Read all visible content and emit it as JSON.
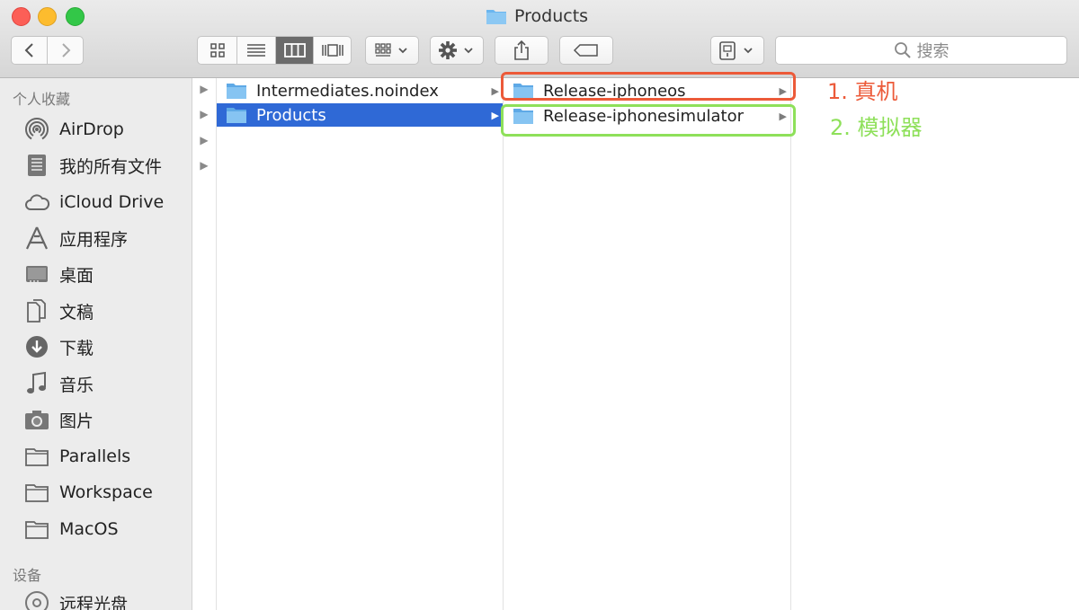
{
  "window": {
    "title": "Products"
  },
  "toolbar": {
    "back_icon": "chevron-left-icon",
    "forward_icon": "chevron-right-icon",
    "view_modes": [
      "icon-view-icon",
      "list-view-icon",
      "column-view-icon",
      "cover-flow-icon"
    ],
    "active_view": "column-view-icon",
    "arrange_icon": "arrange-grid-icon",
    "action_icon": "gear-icon",
    "share_icon": "share-icon",
    "tag_icon": "tag-icon",
    "device_icon": "device-icon",
    "search": {
      "placeholder": "搜索"
    }
  },
  "sidebar": {
    "favorites_header": "个人收藏",
    "favorites": [
      {
        "label": "AirDrop",
        "icon": "airdrop-icon"
      },
      {
        "label": "我的所有文件",
        "icon": "all-files-icon"
      },
      {
        "label": "iCloud Drive",
        "icon": "cloud-icon"
      },
      {
        "label": "应用程序",
        "icon": "applications-icon"
      },
      {
        "label": "桌面",
        "icon": "desktop-icon"
      },
      {
        "label": "文稿",
        "icon": "documents-icon"
      },
      {
        "label": "下载",
        "icon": "downloads-icon"
      },
      {
        "label": "音乐",
        "icon": "music-icon"
      },
      {
        "label": "图片",
        "icon": "camera-icon"
      },
      {
        "label": "Parallels",
        "icon": "folder-icon"
      },
      {
        "label": "Workspace",
        "icon": "folder-icon"
      },
      {
        "label": "MacOS",
        "icon": "folder-icon"
      }
    ],
    "devices_header": "设备",
    "devices": [
      {
        "label": "远程光盘",
        "icon": "disc-icon"
      }
    ]
  },
  "columns": {
    "col2": [
      {
        "name": "Intermediates.noindex",
        "selected": false
      },
      {
        "name": "Products",
        "selected": true
      }
    ],
    "col3": [
      {
        "name": "Release-iphoneos",
        "selected": false
      },
      {
        "name": "Release-iphonesimulator",
        "selected": false
      }
    ]
  },
  "annotations": {
    "red_label": "1. 真机",
    "green_label": "2. 模拟器",
    "red_color": "#ec5a39",
    "green_color": "#8ee05a"
  },
  "colors": {
    "selection": "#2f69d6",
    "folder": "#6bb6ef"
  }
}
